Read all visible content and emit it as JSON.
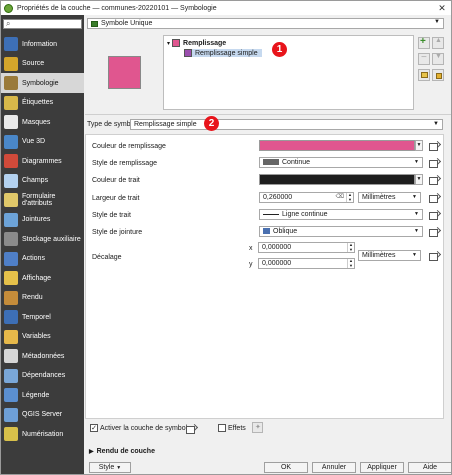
{
  "window": {
    "title": "Propriétés de la couche — communes-20220101 — Symbologie"
  },
  "sidebar": {
    "items": [
      {
        "label": "Information",
        "icon": "information-icon",
        "color": "#3d6fb6"
      },
      {
        "label": "Source",
        "icon": "source-icon",
        "color": "#d4a62b"
      },
      {
        "label": "Symbologie",
        "icon": "symbology-icon",
        "color": "#9a7a3a",
        "active": true
      },
      {
        "label": "Étiquettes",
        "icon": "labels-icon",
        "color": "#d8b84a"
      },
      {
        "label": "Masques",
        "icon": "masks-icon",
        "color": "#eaeaea"
      },
      {
        "label": "Vue 3D",
        "icon": "view3d-icon",
        "color": "#4a87c8"
      },
      {
        "label": "Diagrammes",
        "icon": "diagrams-icon",
        "color": "#d04a3a"
      },
      {
        "label": "Champs",
        "icon": "fields-icon",
        "color": "#b3d1ef"
      },
      {
        "label": "Formulaire d'attributs",
        "icon": "attributes-form-icon",
        "color": "#e0c86a"
      },
      {
        "label": "Jointures",
        "icon": "joins-icon",
        "color": "#6da3d8"
      },
      {
        "label": "Stockage auxiliaire",
        "icon": "auxiliary-storage-icon",
        "color": "#8b8b8b"
      },
      {
        "label": "Actions",
        "icon": "actions-icon",
        "color": "#4f7fc7"
      },
      {
        "label": "Affichage",
        "icon": "display-icon",
        "color": "#e6c14a"
      },
      {
        "label": "Rendu",
        "icon": "rendering-icon",
        "color": "#c58c3a"
      },
      {
        "label": "Temporel",
        "icon": "temporal-icon",
        "color": "#3d6fb6"
      },
      {
        "label": "Variables",
        "icon": "variables-icon",
        "color": "#e6b84a"
      },
      {
        "label": "Métadonnées",
        "icon": "metadata-icon",
        "color": "#d6d6d6"
      },
      {
        "label": "Dépendances",
        "icon": "dependencies-icon",
        "color": "#7aa7d8"
      },
      {
        "label": "Légende",
        "icon": "legend-icon",
        "color": "#5b8fd0"
      },
      {
        "label": "QGIS Server",
        "icon": "qgis-server-icon",
        "color": "#6e9fd6"
      },
      {
        "label": "Numérisation",
        "icon": "digitizing-icon",
        "color": "#d8c04a"
      }
    ]
  },
  "renderer": {
    "selected": "Symbole Unique"
  },
  "tree": {
    "parent": "Remplissage",
    "child": "Remplissage simple",
    "parent_color": "#e0568f",
    "child_color": "#9b4fae"
  },
  "badges": {
    "one": "1",
    "two": "2"
  },
  "symbol_type": {
    "label": "Type de symbole",
    "value": "Remplissage simple"
  },
  "properties": {
    "fill_color_label": "Couleur de remplissage",
    "fill_color": "#e0568f",
    "fill_style_label": "Style de remplissage",
    "fill_style_value": "Continue",
    "stroke_color_label": "Couleur de trait",
    "stroke_color": "#1e1e1e",
    "stroke_width_label": "Largeur de trait",
    "stroke_width_value": "0,260000",
    "stroke_width_unit": "Millimètres",
    "stroke_style_label": "Style de trait",
    "stroke_style_value": "Ligne continue",
    "join_style_label": "Style de jointure",
    "join_style_value": "Oblique",
    "offset_label": "Décalage",
    "offset_x_label": "x",
    "offset_x": "0,000000",
    "offset_y_label": "y",
    "offset_y": "0,000000",
    "offset_unit": "Millimètres"
  },
  "bottom": {
    "enable_symbol_layer": "Activer la couche de symboles",
    "enable_symbol_layer_checked": "✓",
    "effects": "Effets",
    "layer_rendering": "Rendu de couche",
    "style_button": "Style",
    "ok": "OK",
    "cancel": "Annuler",
    "apply": "Appliquer",
    "help": "Aide"
  }
}
